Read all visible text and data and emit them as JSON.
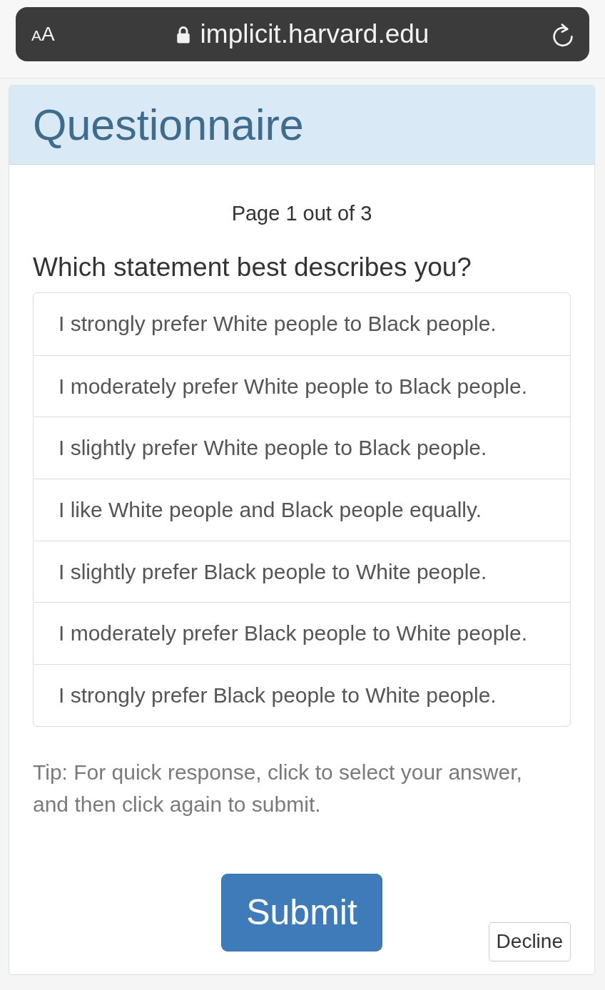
{
  "browser_bar": {
    "text_size_label": "AA",
    "url": "implicit.harvard.edu"
  },
  "panel": {
    "title": "Questionnaire",
    "page_indicator": "Page 1 out of 3",
    "question": "Which statement best describes you?",
    "options": [
      {
        "label": "I strongly prefer White people to Black people.",
        "selected": false
      },
      {
        "label": "I moderately prefer White people to Black people.",
        "selected": false
      },
      {
        "label": "I slightly prefer White people to Black people.",
        "selected": false
      },
      {
        "label": "I like White people and Black people equally.",
        "selected": false
      },
      {
        "label": "I slightly prefer Black people to White people.",
        "selected": false
      },
      {
        "label": "I moderately prefer Black people to White people.",
        "selected": false
      },
      {
        "label": "I strongly prefer Black people to White people.",
        "selected": false
      }
    ],
    "tip": "Tip: For quick response, click to select your answer, and then click again to submit.",
    "buttons": [
      {
        "kind": "primary",
        "label": "Submit"
      },
      {
        "kind": "secondary",
        "label": "Decline"
      }
    ]
  }
}
